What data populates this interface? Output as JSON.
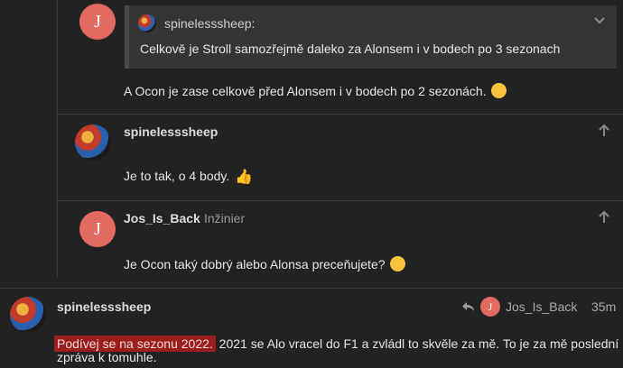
{
  "post1": {
    "avatar_letter": "J",
    "quote": {
      "author": "spinelesssheep:",
      "text": "Celkově je Stroll samozřejmě daleko za Alonsem i v bodech po 3 sezonach"
    },
    "text": "A Ocon je zase celkově před Alonsem i v bodech po 2 sezonách."
  },
  "post2": {
    "username": "spinelesssheep",
    "text": "Je to tak, o 4 body."
  },
  "post3": {
    "avatar_letter": "J",
    "username": "Jos_Is_Back",
    "title": "Inžinier",
    "text": "Je Ocon taký dobrý alebo Alonsa preceňujete?"
  },
  "post4": {
    "username": "spinelesssheep",
    "reply_to": {
      "avatar_letter": "J",
      "username": "Jos_Is_Back"
    },
    "time": "35m",
    "highlighted_text": "Podívej se na sezonu 2022.",
    "text_rest": " 2021 se Alo vracel do F1 a zvládl to skvěle za mě. To je za mě poslední",
    "text_line2": "zpráva k tomuhle."
  },
  "colors": {
    "background": "#222222",
    "letter_avatar": "#e36a60",
    "highlight": "#9b1d1d"
  },
  "icons": [
    "reply-arrow-icon",
    "chevron-down-icon",
    "arrow-up-icon",
    "shushing-face-emoji",
    "thumbs-up-emoji",
    "thinking-face-emoji"
  ]
}
